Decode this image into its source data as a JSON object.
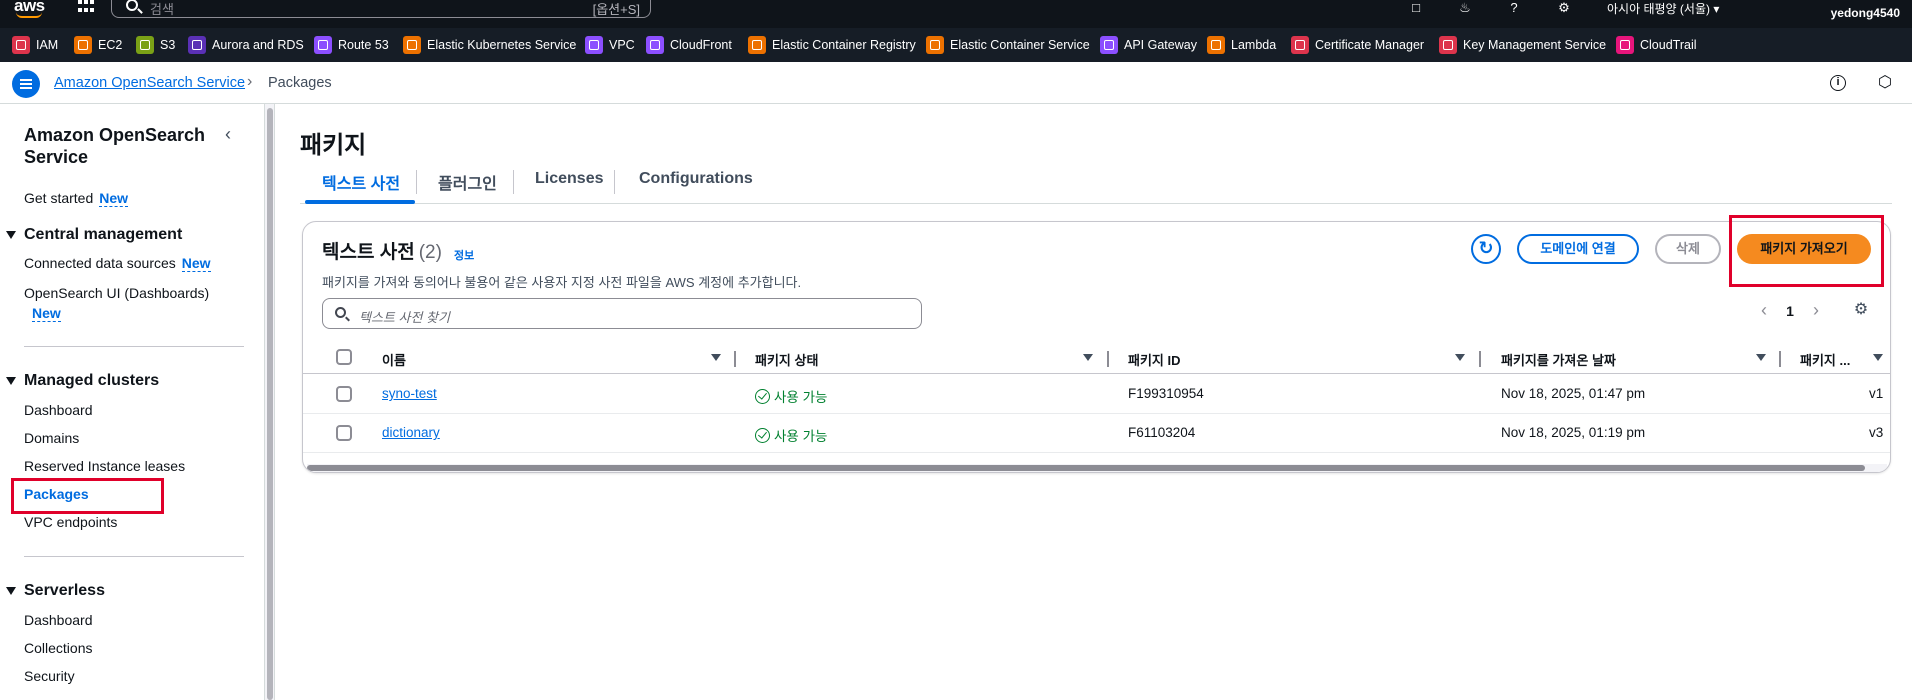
{
  "topnav": {
    "logo": "aws",
    "search_placeholder": "검색",
    "search_shortcut": "[옵션+S]",
    "region": "아시아 태평양 (서울)",
    "user": "yedong4540",
    "icons": [
      "cloudshell-icon",
      "bell-icon",
      "help-icon",
      "gear-icon"
    ]
  },
  "favorites": [
    {
      "label": "IAM",
      "color": "#dd344c"
    },
    {
      "label": "EC2",
      "color": "#ed7100"
    },
    {
      "label": "S3",
      "color": "#7aa116"
    },
    {
      "label": "Aurora and RDS",
      "color": "#c925d1"
    },
    {
      "label": "Route 53",
      "color": "#8c4fff"
    },
    {
      "label": "Elastic Kubernetes Service",
      "color": "#ed7100"
    },
    {
      "label": "VPC",
      "color": "#8c4fff"
    },
    {
      "label": "CloudFront",
      "color": "#8c4fff"
    },
    {
      "label": "Elastic Container Registry",
      "color": "#ed7100"
    },
    {
      "label": "Elastic Container Service",
      "color": "#ed7100"
    },
    {
      "label": "API Gateway",
      "color": "#8c4fff"
    },
    {
      "label": "Lambda",
      "color": "#ed7100"
    },
    {
      "label": "Certificate Manager",
      "color": "#dd344c"
    },
    {
      "label": "Key Management Service",
      "color": "#dd344c"
    },
    {
      "label": "CloudTrail",
      "color": "#e7157b"
    }
  ],
  "breadcrumb": {
    "service": "Amazon OpenSearch Service",
    "current": "Packages"
  },
  "sidebar": {
    "title": "Amazon OpenSearch Service",
    "get_started": "Get started",
    "new_badge": "New",
    "central": {
      "heading": "Central management",
      "items": [
        "Connected data sources",
        "OpenSearch UI (Dashboards)"
      ]
    },
    "managed": {
      "heading": "Managed clusters",
      "items": [
        "Dashboard",
        "Domains",
        "Reserved Instance leases",
        "Packages",
        "VPC endpoints"
      ]
    },
    "serverless": {
      "heading": "Serverless",
      "items": [
        "Dashboard",
        "Collections",
        "Security"
      ]
    }
  },
  "main": {
    "title": "패키지",
    "tabs": [
      "텍스트 사전",
      "플러그인",
      "Licenses",
      "Configurations"
    ],
    "card": {
      "title": "텍스트 사전",
      "count": "(2)",
      "info": "정보",
      "description": "패키지를 가져와 동의어나 불용어 같은 사용자 지정 사전 파일을 AWS 계정에 추가합니다.",
      "btn_associate": "도메인에 연결",
      "btn_delete": "삭제",
      "btn_import": "패키지 가져오기",
      "search_placeholder": "텍스트 사전 찾기",
      "page": "1",
      "columns": [
        "이름",
        "패키지 상태",
        "패키지 ID",
        "패키지를 가져온 날짜",
        "패키지 ..."
      ],
      "rows": [
        {
          "name": "syno-test",
          "status": "사용 가능",
          "id": "F199310954",
          "date": "Nov 18, 2025, 01:47 pm",
          "version": "v1"
        },
        {
          "name": "dictionary",
          "status": "사용 가능",
          "id": "F61103204",
          "date": "Nov 18, 2025, 01:19 pm",
          "version": "v3"
        }
      ]
    }
  },
  "colors": {
    "accent": "#006ce0",
    "primary_button": "#f58a1f",
    "highlight_box": "#e0002a",
    "success": "#00802f"
  }
}
